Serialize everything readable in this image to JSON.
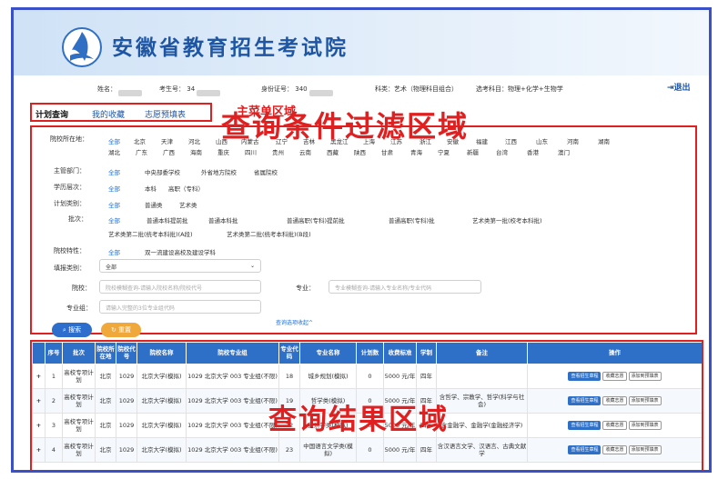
{
  "header": {
    "title": "安徽省教育招生考试院"
  },
  "userbar": {
    "name_label": "姓名：",
    "exam_no_label": "考生号：",
    "exam_no_prefix": "34",
    "id_label": "身份证号：",
    "id_prefix": "340",
    "subject_label": "科类：艺术（物理科目组合）",
    "elective_label": "选考科目：物理+化学+生物学",
    "logout": "退出"
  },
  "menu": {
    "tabs": [
      "计划查询",
      "我的收藏",
      "志愿预填表"
    ],
    "annotation": "主菜单区域"
  },
  "filter": {
    "annotation": "查询条件过滤区域",
    "location": {
      "label": "院校所在地：",
      "options_row1": [
        "全部",
        "北京",
        "天津",
        "河北",
        "山西",
        "内蒙古",
        "辽宁",
        "吉林",
        "黑龙江",
        "上海",
        "江苏",
        "浙江",
        "安徽",
        "福建",
        "江西",
        "山东",
        "河南",
        "湖南"
      ],
      "options_row2": [
        "湖北",
        "广东",
        "广西",
        "海南",
        "重庆",
        "四川",
        "贵州",
        "云南",
        "西藏",
        "陕西",
        "甘肃",
        "青海",
        "宁夏",
        "新疆",
        "台湾",
        "香港",
        "澳门"
      ]
    },
    "dept": {
      "label": "主管部门：",
      "options": [
        "全部",
        "中央部委学校",
        "外省地方院校",
        "省属院校"
      ]
    },
    "level": {
      "label": "学历层次：",
      "options": [
        "全部",
        "本科",
        "高职（专科）"
      ]
    },
    "plan_type": {
      "label": "计划类别：",
      "options": [
        "全部",
        "普通类",
        "艺术类"
      ]
    },
    "batch": {
      "label": "批次：",
      "options_row1": [
        "全部",
        "普通本科提前批",
        "普通本科批",
        "普通高职(专科)提前批",
        "普通高职(专科)批",
        "艺术类第一批(校考本科批)"
      ],
      "options_row2": [
        "艺术类第二批(统考本科批)(A段)",
        "艺术类第二批(统考本科批)(B段)"
      ]
    },
    "features": {
      "label": "院校特性：",
      "options": [
        "全部",
        "双一流建设高校及建设学科"
      ]
    },
    "fill_type": {
      "label": "填报类别：",
      "value": "全部"
    },
    "school": {
      "label": "院校：",
      "placeholder": "院校模糊查询-请输入院校名称/院校代号"
    },
    "major": {
      "label": "专业：",
      "placeholder": "专业模糊查询-请输入专业名称/专业代码"
    },
    "major_group": {
      "label": "专业组：",
      "placeholder": "请输入完整的3位专业组代码"
    },
    "search_btn": "搜索",
    "reset_btn": "重置",
    "collapse_link": "查询选项收起^"
  },
  "results": {
    "annotation": "查询结果区域",
    "headers": [
      "",
      "序号",
      "批次",
      "院校所在地",
      "院校代号",
      "院校名称",
      "院校专业组",
      "专业代码",
      "专业名称",
      "计划数",
      "收费标准",
      "学制",
      "备注",
      "操作"
    ],
    "rows": [
      [
        "+",
        "1",
        "高校专项计划",
        "北京",
        "1029",
        "北京大学(模拟)",
        "1029 北京大学 003 专业组(不限)",
        "18",
        "城乡规划(模拟)",
        "0",
        "5000 元/年",
        "四年",
        "",
        ""
      ],
      [
        "+",
        "2",
        "高校专项计划",
        "北京",
        "1029",
        "北京大学(模拟)",
        "1029 北京大学 003 专业组(不限)",
        "19",
        "哲学类(模拟)",
        "0",
        "5000 元/年",
        "四年",
        "含哲学、宗教学、哲学(科学与社会)",
        ""
      ],
      [
        "+",
        "3",
        "高校专项计划",
        "北京",
        "1029",
        "北京大学(模拟)",
        "1029 北京大学 003 专业组(不限)",
        "22",
        "经济学类(模拟)",
        "0",
        "5000 元/年",
        "四年",
        "含金融学、金融学(金融经济学)",
        ""
      ],
      [
        "+",
        "4",
        "高校专项计划",
        "北京",
        "1029",
        "北京大学(模拟)",
        "1029 北京大学 003 专业组(不限)",
        "23",
        "中国语言文学类(模拟)",
        "0",
        "5000 元/年",
        "四年",
        "含汉语言文学、汉语言、古典文献学",
        ""
      ]
    ],
    "ops": [
      "查看招生章程",
      "收藏志愿",
      "添加到预填表"
    ]
  }
}
